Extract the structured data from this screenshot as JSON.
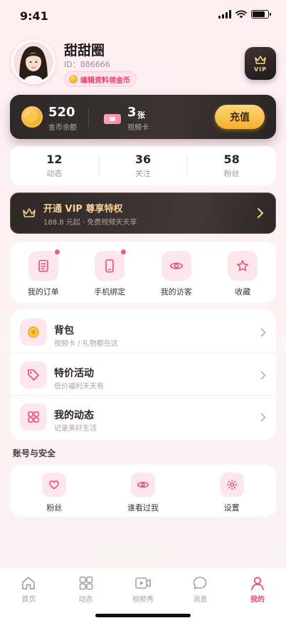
{
  "status": {
    "time": "9:41"
  },
  "profile": {
    "name": "甜甜圈",
    "id_text": "ID：886666",
    "edit_label": "编辑资料领金币",
    "vip_label": "VIP"
  },
  "wallet": {
    "coins": "520",
    "coins_label": "金币余额",
    "cards": "3",
    "cards_unit": "张",
    "cards_label": "视频卡",
    "recharge_label": "充值"
  },
  "stats": [
    {
      "value": "12",
      "label": "动态"
    },
    {
      "value": "36",
      "label": "关注"
    },
    {
      "value": "58",
      "label": "粉丝"
    }
  ],
  "vip_banner": {
    "title": "开通 VIP 尊享特权",
    "subtitle": "188.8 元起 · 免费视频天天享"
  },
  "quick_actions": [
    {
      "label": "我的订单",
      "icon": "order-icon",
      "badge": true
    },
    {
      "label": "手机绑定",
      "icon": "phone-icon",
      "badge": true
    },
    {
      "label": "我的访客",
      "icon": "eye-icon",
      "badge": false
    },
    {
      "label": "收藏",
      "icon": "star-icon",
      "badge": false
    }
  ],
  "menu": [
    {
      "title": "背包",
      "subtitle": "视频卡 / 礼物都在这",
      "icon": "coin-icon"
    },
    {
      "title": "特价活动",
      "subtitle": "低价福利天天有",
      "icon": "tag-icon"
    },
    {
      "title": "我的动态",
      "subtitle": "记录美好生活",
      "icon": "grid-icon"
    }
  ],
  "security": {
    "title": "账号与安全",
    "items": [
      {
        "label": "粉丝",
        "icon": "heart-icon"
      },
      {
        "label": "谁看过我",
        "icon": "eye-icon"
      },
      {
        "label": "设置",
        "icon": "gear-icon"
      }
    ]
  },
  "tabs": [
    {
      "label": "首页",
      "icon": "home-icon",
      "active": false
    },
    {
      "label": "动态",
      "icon": "grid-icon",
      "active": false
    },
    {
      "label": "视频秀",
      "icon": "video-icon",
      "active": false
    },
    {
      "label": "消息",
      "icon": "chat-icon",
      "active": false
    },
    {
      "label": "我的",
      "icon": "user-icon",
      "active": true
    }
  ],
  "colors": {
    "accent": "#ec4a74",
    "gold": "#f6d48b",
    "dark": "#2e2728"
  }
}
